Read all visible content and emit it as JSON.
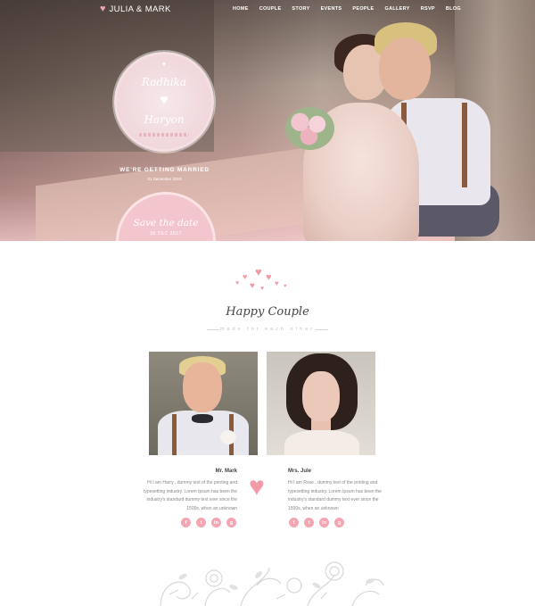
{
  "nav": {
    "logo": "JULIA & MARK",
    "items": [
      "HOME",
      "COUPLE",
      "STORY",
      "EVENTS",
      "PEOPLE",
      "GALLERY",
      "RSVP",
      "BLOG"
    ]
  },
  "hero": {
    "badge_name_1": "Radhika",
    "badge_name_2": "Haryon",
    "headline": "WE'RE GETTING MARRIED",
    "date": "31 December 2019",
    "save_title": "Save the date",
    "save_date": "30 DEC 2017"
  },
  "couple": {
    "title": "Happy Couple",
    "subtitle": "made for each other",
    "groom": {
      "name": "Mr. Mark",
      "bio": "Hi I am Harry , dummy text of the printing and typesetting industry. Lorem Ipsum has been the industry's standard dummy text ever since the 1500s, when an unknown"
    },
    "bride": {
      "name": "Mrs. Jule",
      "bio": "Hi I am Rose , dummy text of the printing and typesetting industry. Lorem Ipsum has been the industry's standard dummy text ever since the 1500s, when an unknown"
    },
    "social_icons": [
      "f",
      "t",
      "in",
      "g"
    ]
  },
  "colors": {
    "accent": "#f29aa8",
    "hero_overlay": "#e8b5be"
  }
}
